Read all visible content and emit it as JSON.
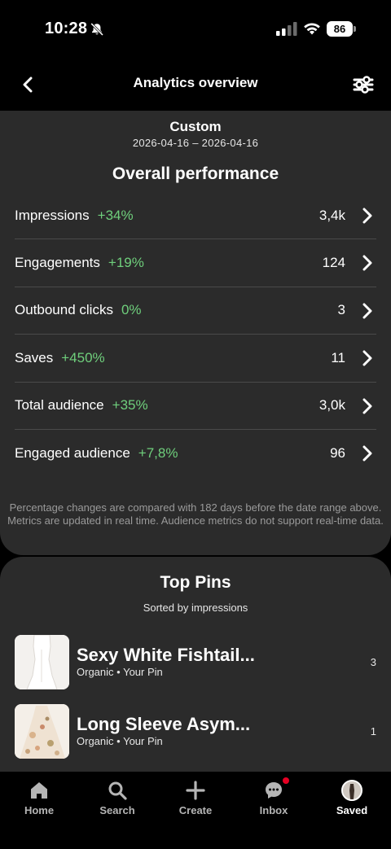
{
  "status_bar": {
    "time": "10:28",
    "battery": "86",
    "icons": [
      "bell-slash-icon",
      "cellular-signal-icon",
      "wifi-icon",
      "battery-icon"
    ]
  },
  "header": {
    "title": "Analytics overview",
    "back_icon": "chevron-left-icon",
    "filter_icon": "sliders-icon"
  },
  "date_range": {
    "label": "Custom",
    "dates": "2026-04-16 – 2026-04-16"
  },
  "performance": {
    "title": "Overall performance",
    "metrics": [
      {
        "label": "Impressions",
        "change": "+34%",
        "value": "3,4k"
      },
      {
        "label": "Engagements",
        "change": "+19%",
        "value": "124"
      },
      {
        "label": "Outbound clicks",
        "change": "0%",
        "value": "3"
      },
      {
        "label": "Saves",
        "change": "+450%",
        "value": "11"
      },
      {
        "label": "Total audience",
        "change": "+35%",
        "value": "3,0k"
      },
      {
        "label": "Engaged audience",
        "change": "+7,8%",
        "value": "96"
      }
    ],
    "note": "Percentage changes are compared with 182 days before the date range above. Metrics are updated in real time. Audience metrics do not support real-time data."
  },
  "top_pins": {
    "title": "Top Pins",
    "subtitle": "Sorted by impressions",
    "pins": [
      {
        "title": "Sexy White Fishtail...",
        "source": "Organic",
        "owner": "Your Pin",
        "count": "3"
      },
      {
        "title": "Long Sleeve Asym...",
        "source": "Organic",
        "owner": "Your Pin",
        "count": "1"
      }
    ]
  },
  "tab_bar": {
    "tabs": [
      {
        "label": "Home",
        "icon": "home-icon",
        "active": false
      },
      {
        "label": "Search",
        "icon": "search-icon",
        "active": false
      },
      {
        "label": "Create",
        "icon": "plus-icon",
        "active": false
      },
      {
        "label": "Inbox",
        "icon": "chat-icon",
        "active": false,
        "badge": true
      },
      {
        "label": "Saved",
        "icon": "avatar-icon",
        "active": true
      }
    ]
  },
  "colors": {
    "background": "#000000",
    "card": "#2b2b2b",
    "positive_change": "#6fcf7c",
    "divider": "#4a4a4a",
    "notification": "#e60023"
  }
}
